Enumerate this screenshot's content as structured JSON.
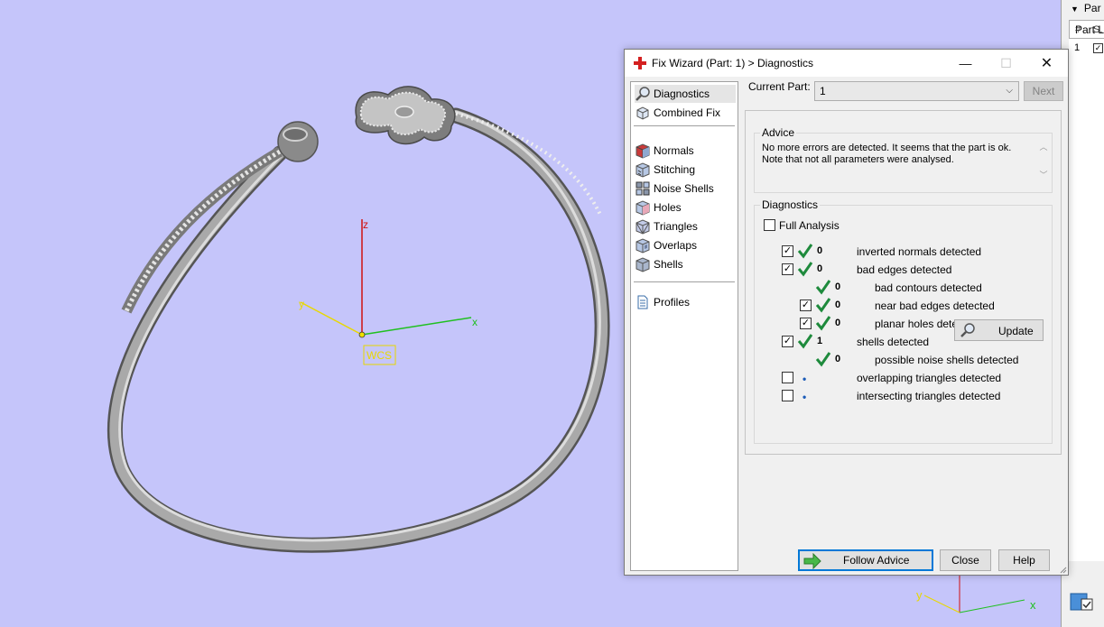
{
  "viewport": {
    "axis_z": "z",
    "axis_y": "y",
    "axis_x": "x",
    "wcs_label": "WCS",
    "mini_axis_y": "y",
    "mini_axis_x": "x"
  },
  "right_panel": {
    "header": "Par",
    "tab": "Part Lis",
    "col_num": "#",
    "col_s": "S.",
    "row_num": "1"
  },
  "dialog": {
    "title": "Fix Wizard (Part: 1) > Diagnostics",
    "minimize": "—",
    "maximize": "☐",
    "close": "✕"
  },
  "sidebar": {
    "items": [
      {
        "label": "Diagnostics",
        "icon": "magnifier-icon"
      },
      {
        "label": "Combined Fix",
        "icon": "cube-outline-icon"
      },
      {
        "label": "Normals",
        "icon": "normals-cube-icon"
      },
      {
        "label": "Stitching",
        "icon": "stitching-cube-icon"
      },
      {
        "label": "Noise Shells",
        "icon": "noise-shells-icon"
      },
      {
        "label": "Holes",
        "icon": "holes-cube-icon"
      },
      {
        "label": "Triangles",
        "icon": "triangles-cube-icon"
      },
      {
        "label": "Overlaps",
        "icon": "overlaps-cube-icon"
      },
      {
        "label": "Shells",
        "icon": "shells-cube-icon"
      },
      {
        "label": "Profiles",
        "icon": "document-icon"
      }
    ]
  },
  "part": {
    "label": "Current Part:",
    "value": "1",
    "next": "Next"
  },
  "advice": {
    "title": "Advice",
    "line1": "No more errors are detected. It seems that the part is ok.",
    "line2": "Note that not all parameters were analysed."
  },
  "diagnostics": {
    "title": "Diagnostics",
    "full_analysis": "Full Analysis",
    "rows": [
      {
        "checkbox": true,
        "status": "ok",
        "count": "0",
        "label": "inverted normals detected"
      },
      {
        "checkbox": true,
        "status": "ok",
        "count": "0",
        "label": "bad edges detected"
      },
      {
        "checkbox": false,
        "status": "ok",
        "count": "0",
        "label": "bad contours detected"
      },
      {
        "checkbox": true,
        "status": "ok",
        "count": "0",
        "label": "near bad edges detected"
      },
      {
        "checkbox": true,
        "status": "ok",
        "count": "0",
        "label": "planar holes detected"
      },
      {
        "checkbox": true,
        "status": "ok",
        "count": "1",
        "label": "shells detected"
      },
      {
        "checkbox": false,
        "status": "ok",
        "count": "0",
        "label": "possible noise shells detected"
      },
      {
        "checkbox": false,
        "status": "pending",
        "count": "•",
        "label": "overlapping triangles detected"
      },
      {
        "checkbox": false,
        "status": "pending",
        "count": "•",
        "label": "intersecting triangles detected"
      }
    ],
    "update": "Update"
  },
  "buttons": {
    "follow_advice": "Follow Advice",
    "close": "Close",
    "help": "Help"
  },
  "colors": {
    "viewport_bg": "#c5c5fa",
    "accent": "#0078d7",
    "check_green": "#1e8a3c",
    "axis_z": "#d01010",
    "axis_x": "#20c020",
    "axis_y": "#e8d800"
  }
}
